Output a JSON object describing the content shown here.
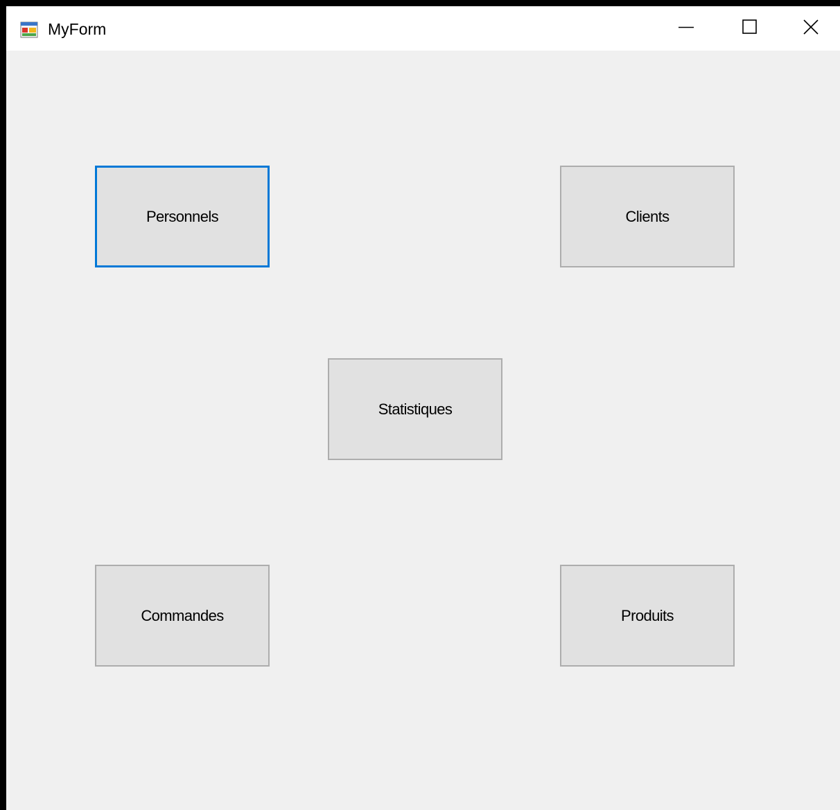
{
  "window": {
    "title": "MyForm",
    "app_icon": "winforms-app-icon",
    "controls": {
      "minimize_icon": "minimize-icon",
      "maximize_icon": "maximize-icon",
      "close_icon": "close-icon"
    }
  },
  "buttons": {
    "personnels": "Personnels",
    "clients": "Clients",
    "statistiques": "Statistiques",
    "commandes": "Commandes",
    "produits": "Produits"
  },
  "focused_button": "personnels",
  "colors": {
    "form_background": "#f0f0f0",
    "titlebar_background": "#ffffff",
    "button_face": "#e1e1e1",
    "button_border": "#adadad",
    "focus_border": "#0078d7"
  }
}
